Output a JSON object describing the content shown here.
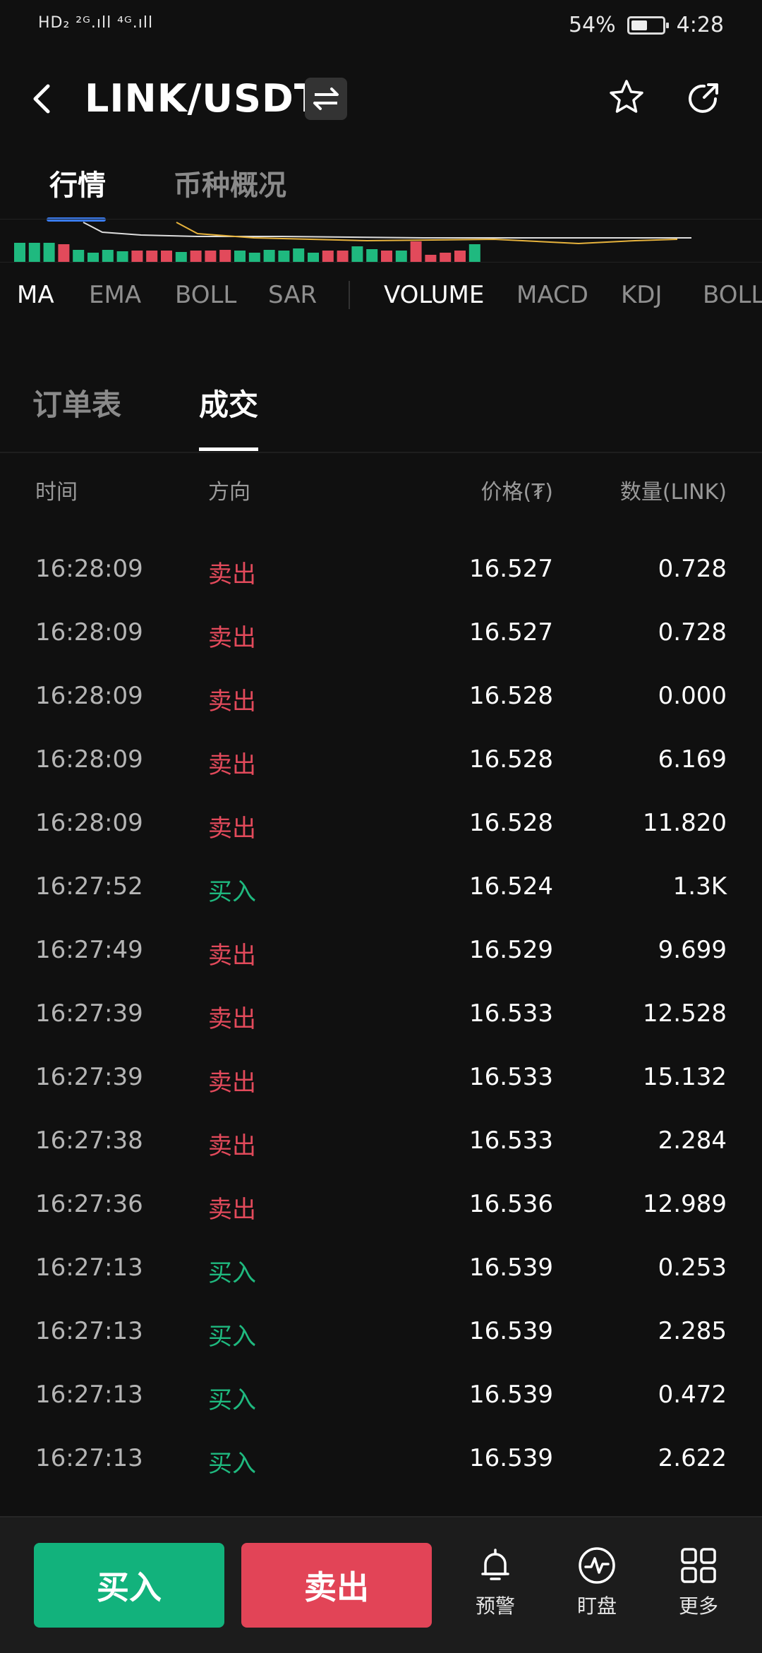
{
  "status_bar": {
    "left": "HD₂ ²ᴳ.ıll ⁴ᴳ.ıll",
    "battery": "54%",
    "battery_level": 0.54,
    "time": "4:28"
  },
  "header": {
    "pair": "LINK/USDT"
  },
  "tabs": [
    {
      "label": "行情",
      "active": true
    },
    {
      "label": "币种概况",
      "active": false
    }
  ],
  "indicators_main": [
    "MA",
    "EMA",
    "BOLL",
    "SAR"
  ],
  "indicators_sub": [
    "VOLUME",
    "MACD",
    "KDJ",
    "BOLL"
  ],
  "order_tabs": [
    {
      "label": "订单表",
      "active": false
    },
    {
      "label": "成交",
      "active": true
    }
  ],
  "table": {
    "headers": {
      "time": "时间",
      "direction": "方向",
      "price": "价格(₮)",
      "qty": "数量(LINK)"
    },
    "rows": [
      {
        "time": "16:28:09",
        "direction": "卖出",
        "side": "sell",
        "price": "16.527",
        "qty": "0.728"
      },
      {
        "time": "16:28:09",
        "direction": "卖出",
        "side": "sell",
        "price": "16.527",
        "qty": "0.728"
      },
      {
        "time": "16:28:09",
        "direction": "卖出",
        "side": "sell",
        "price": "16.528",
        "qty": "0.000"
      },
      {
        "time": "16:28:09",
        "direction": "卖出",
        "side": "sell",
        "price": "16.528",
        "qty": "6.169"
      },
      {
        "time": "16:28:09",
        "direction": "卖出",
        "side": "sell",
        "price": "16.528",
        "qty": "11.820"
      },
      {
        "time": "16:27:52",
        "direction": "买入",
        "side": "buy",
        "price": "16.524",
        "qty": "1.3K"
      },
      {
        "time": "16:27:49",
        "direction": "卖出",
        "side": "sell",
        "price": "16.529",
        "qty": "9.699"
      },
      {
        "time": "16:27:39",
        "direction": "卖出",
        "side": "sell",
        "price": "16.533",
        "qty": "12.528"
      },
      {
        "time": "16:27:39",
        "direction": "卖出",
        "side": "sell",
        "price": "16.533",
        "qty": "15.132"
      },
      {
        "time": "16:27:38",
        "direction": "卖出",
        "side": "sell",
        "price": "16.533",
        "qty": "2.284"
      },
      {
        "time": "16:27:36",
        "direction": "卖出",
        "side": "sell",
        "price": "16.536",
        "qty": "12.989"
      },
      {
        "time": "16:27:13",
        "direction": "买入",
        "side": "buy",
        "price": "16.539",
        "qty": "0.253"
      },
      {
        "time": "16:27:13",
        "direction": "买入",
        "side": "buy",
        "price": "16.539",
        "qty": "2.285"
      },
      {
        "time": "16:27:13",
        "direction": "买入",
        "side": "buy",
        "price": "16.539",
        "qty": "0.472"
      },
      {
        "time": "16:27:13",
        "direction": "买入",
        "side": "buy",
        "price": "16.539",
        "qty": "2.622"
      }
    ]
  },
  "bottom_bar": {
    "buy_label": "买入",
    "sell_label": "卖出",
    "alert_label": "预警",
    "watch_label": "盯盘",
    "more_label": "更多"
  },
  "colors": {
    "buy": "#1fb97f",
    "sell": "#e24a5b",
    "accent": "#3a7bf0",
    "background": "#101010"
  },
  "volume_strip": {
    "bars": [
      "g",
      "g",
      "g",
      "r",
      "g",
      "g",
      "g",
      "g",
      "r",
      "r",
      "r",
      "g",
      "r",
      "r",
      "r",
      "g",
      "g",
      "g",
      "g",
      "g",
      "g",
      "r",
      "r",
      "g",
      "g",
      "r",
      "g",
      "r",
      "r",
      "r",
      "r",
      "g"
    ],
    "levels": [
      0.45,
      0.45,
      0.45,
      0.42,
      0.28,
      0.22,
      0.28,
      0.25,
      0.26,
      0.26,
      0.26,
      0.24,
      0.26,
      0.26,
      0.28,
      0.26,
      0.22,
      0.28,
      0.26,
      0.32,
      0.22,
      0.26,
      0.26,
      0.36,
      0.3,
      0.26,
      0.26,
      0.48,
      0.16,
      0.22,
      0.26,
      0.42
    ]
  }
}
